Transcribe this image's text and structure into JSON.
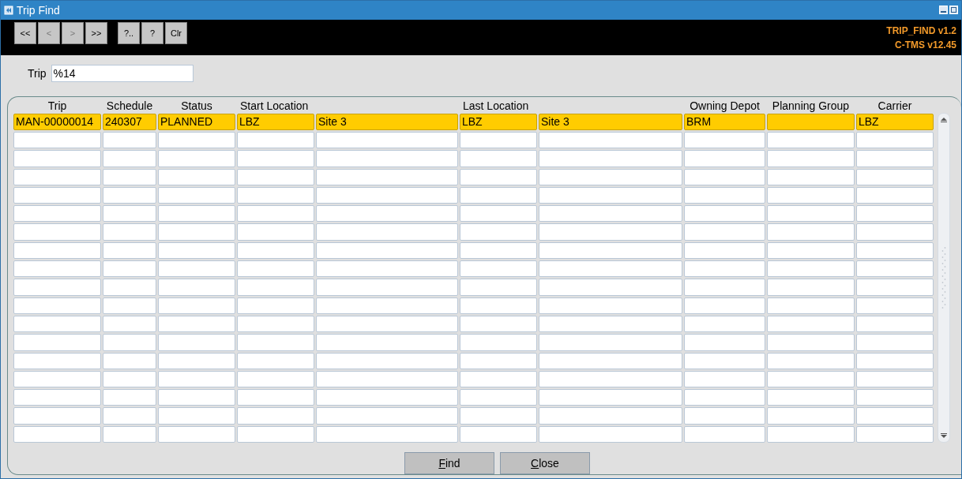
{
  "window": {
    "title": "Trip Find"
  },
  "toolbar": {
    "buttons": [
      {
        "label": "<<",
        "disabled": false
      },
      {
        "label": "<",
        "disabled": true
      },
      {
        "label": ">",
        "disabled": true
      },
      {
        "label": ">>",
        "disabled": false
      },
      {
        "label": "?..",
        "disabled": false
      },
      {
        "label": "?",
        "disabled": false
      },
      {
        "label": "Clr",
        "disabled": false
      }
    ],
    "version_lines": [
      "TRIP_FIND v1.2",
      "C-TMS v12.45"
    ]
  },
  "search": {
    "label": "Trip",
    "value": "%14"
  },
  "table": {
    "columns": [
      {
        "label": "Trip"
      },
      {
        "label": "Schedule"
      },
      {
        "label": "Status"
      },
      {
        "label": "Start Location"
      },
      {},
      {
        "label": "Last Location"
      },
      {},
      {
        "label": "Owning Depot"
      },
      {
        "label": "Planning Group"
      },
      {
        "label": "Carrier"
      }
    ],
    "rows": [
      {
        "selected": true,
        "cells": [
          "MAN-00000014",
          "240307",
          "PLANNED",
          "LBZ",
          "Site 3",
          "LBZ",
          "Site 3",
          "BRM",
          null,
          "LBZ"
        ]
      }
    ]
  },
  "buttons": [
    {
      "label": "Find",
      "mnemonic": true
    },
    {
      "label": "Close",
      "mnemonic": true
    }
  ]
}
